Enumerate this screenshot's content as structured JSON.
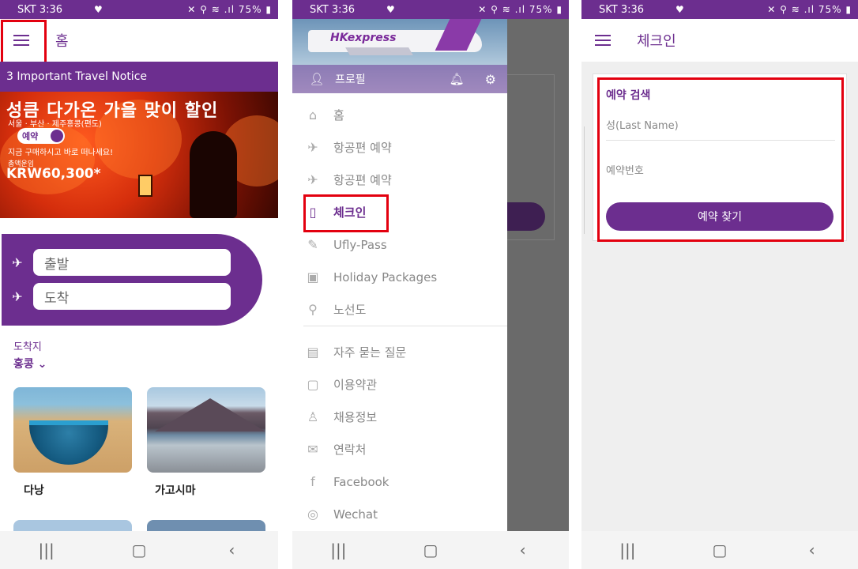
{
  "status": {
    "carrier_time": "SKT 3:36",
    "right": "✕ ⚲ ≋ .ıl 75% ▮"
  },
  "screen1": {
    "title": "홈",
    "notice": "3 Important Travel Notice",
    "banner": {
      "headline": "성큼 다가온 가을 맞이 할인",
      "cities": "서울 · 부산 · 제주홍콩(편도)",
      "toggle_label": "예약",
      "promo": "지금 구매하시고 바로 떠나세요!",
      "fare_label": "총액운임",
      "price": "KRW60,300*"
    },
    "search": {
      "from": "출발",
      "to": "도착"
    },
    "destination": {
      "label": "도착지",
      "value": "홍콩 ⌄"
    },
    "cards": [
      "다낭",
      "가고시마"
    ]
  },
  "screen2": {
    "brand": "HKexpress",
    "profile": "프로필",
    "menu": [
      {
        "icon": "home-icon",
        "glyph": "⌂",
        "label": "홈"
      },
      {
        "icon": "plane-takeoff-icon",
        "glyph": "✈",
        "label": "항공편 예약"
      },
      {
        "icon": "plane-icon",
        "glyph": "✈",
        "label": "항공편 예약"
      },
      {
        "icon": "phone-check-icon",
        "glyph": "▯",
        "label": "체크인"
      },
      {
        "icon": "ticket-pen-icon",
        "glyph": "✎",
        "label": "Ufly-Pass"
      },
      {
        "icon": "luggage-icon",
        "glyph": "▣",
        "label": "Holiday Packages"
      },
      {
        "icon": "map-pin-icon",
        "glyph": "⚲",
        "label": "노선도"
      },
      {
        "icon": "chat-icon",
        "glyph": "▤",
        "label": "자주 묻는 질문"
      },
      {
        "icon": "document-search-icon",
        "glyph": "▢",
        "label": "이용약관"
      },
      {
        "icon": "person-add-icon",
        "glyph": "♙",
        "label": "채용정보"
      },
      {
        "icon": "envelope-icon",
        "glyph": "✉",
        "label": "연락처"
      },
      {
        "icon": "facebook-icon",
        "glyph": "f",
        "label": "Facebook"
      },
      {
        "icon": "wechat-icon",
        "glyph": "◎",
        "label": "Wechat"
      }
    ]
  },
  "screen3": {
    "title": "체크인",
    "form_title": "예약 검색",
    "last_name_placeholder": "성(Last Name)",
    "booking_placeholder": "예약번호",
    "button": "예약 찾기"
  },
  "colors": {
    "brand": "#6c2e8f",
    "highlight": "#e3000f"
  }
}
